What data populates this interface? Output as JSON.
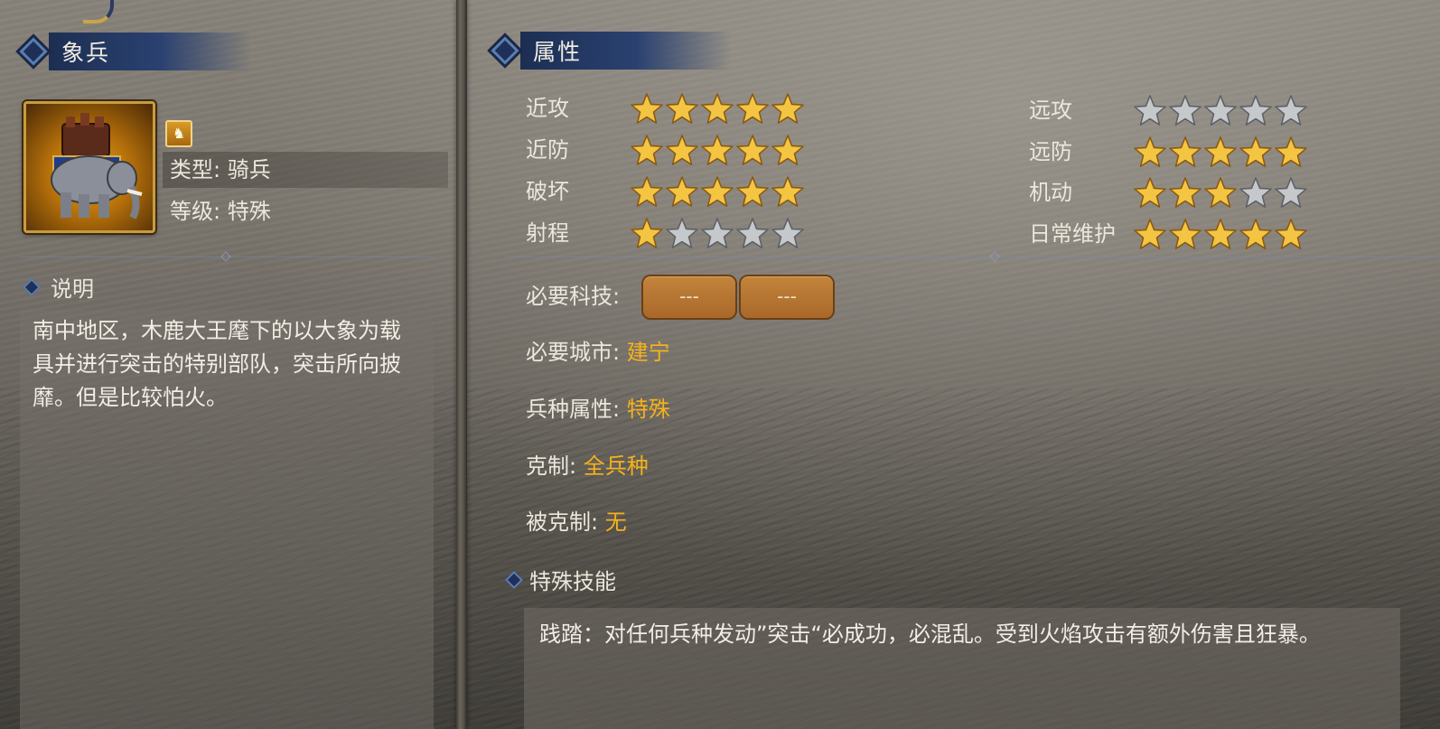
{
  "unit": {
    "name": "象兵",
    "type_line": "类型: 骑兵",
    "grade_line": "等级: 特殊",
    "type_icon": "horse-icon"
  },
  "description": {
    "heading": "说明",
    "text": "南中地区，木鹿大王麾下的以大象为载具并进行突击的特别部队，突击所向披靡。但是比较怕火。"
  },
  "attributes": {
    "heading": "属性",
    "stats_left": [
      {
        "label": "近攻",
        "rating": 5
      },
      {
        "label": "近防",
        "rating": 5
      },
      {
        "label": "破坏",
        "rating": 5
      },
      {
        "label": "射程",
        "rating": 1
      }
    ],
    "stats_right": [
      {
        "label": "远攻",
        "rating": 0
      },
      {
        "label": "远防",
        "rating": 5
      },
      {
        "label": "机动",
        "rating": 3
      },
      {
        "label": "日常维护",
        "rating": 5
      }
    ],
    "max_rating": 5,
    "required_tech_label": "必要科技:",
    "required_tech_slots": [
      "---",
      "---"
    ],
    "required_city_label": "必要城市:",
    "required_city_value": "建宁",
    "troop_attr_label": "兵种属性:",
    "troop_attr_value": "特殊",
    "counters_label": "克制:",
    "counters_value": "全兵种",
    "countered_by_label": "被克制:",
    "countered_by_value": "无"
  },
  "special_skill": {
    "heading": "特殊技能",
    "text": "践踏：对任何兵种发动”突击“必成功，必混乱。受到火焰攻击有额外伤害且狂暴。"
  },
  "colors": {
    "star_gold": "#f4c542",
    "star_silver": "#c6c9cc",
    "header_blue": "#2a4170",
    "value_orange": "#f6b21c"
  }
}
